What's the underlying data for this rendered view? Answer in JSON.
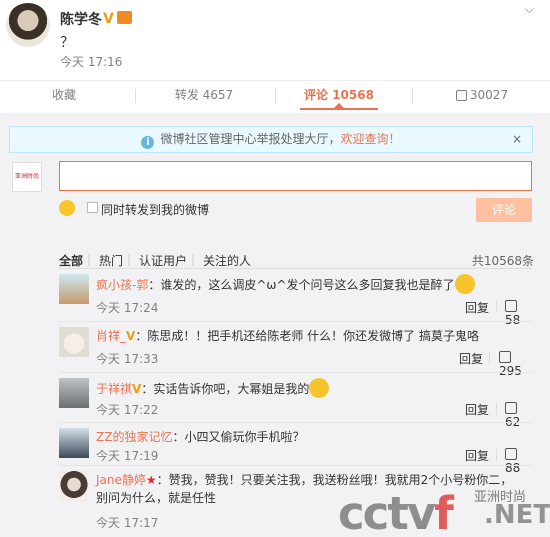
{
  "post": {
    "author": "陈学冬",
    "verified": "V",
    "text": "？",
    "time": "今天 17:16",
    "caret": "⌵"
  },
  "actions": [
    {
      "label": "收藏"
    },
    {
      "label": "转发 4657"
    },
    {
      "label": "评论 10568"
    },
    {
      "label": "30027"
    }
  ],
  "notice": {
    "prefix": "微博社区管理中心举报处理大厅，",
    "link": "欢迎查询！",
    "close": "×"
  },
  "composer": {
    "avatar_text": "亚洲时尚",
    "reply_value": "",
    "repost_label": "同时转发到我的微博",
    "submit_label": "评论"
  },
  "filters": {
    "items": [
      "全部",
      "热门",
      "认证用户",
      "关注的人"
    ],
    "total": "共10568条"
  },
  "comments": [
    {
      "name": "疯小孩-郭",
      "text": "：谁发的，这么调皮^ω^发个问号这么多回复我也是醉了",
      "time": "今天 17:24",
      "reply": "回复",
      "likes": "58"
    },
    {
      "name": "肖祥_",
      "badge": "V",
      "text": "：陈思成！！把手机还给陈老师 什么！你还发微博了 搞莫子鬼咯",
      "time": "今天 17:33",
      "reply": "回复",
      "likes": "295"
    },
    {
      "name": "于祥祺",
      "badge": "V",
      "text": "：实话告诉你吧，大幂姐是我的",
      "time": "今天 17:22",
      "reply": "回复",
      "likes": "62"
    },
    {
      "name": "ZZ的独家记忆",
      "text": "：小四又偷玩你手机啦？",
      "time": "今天 17:19",
      "reply": "回复",
      "likes": "88"
    },
    {
      "name": "Jane静婷",
      "badge": "★",
      "text": "：赞我，赞我！只要关注我，我送粉丝哦！我就用2个小号粉你二，别问为什么，就是任性",
      "time": "今天 17:17",
      "reply": "",
      "likes": ""
    }
  ],
  "watermark": {
    "brand_pre": "cctv",
    "brand_f": "f",
    "net": ".NET",
    "cn": "亚洲时尚"
  },
  "colors": {
    "accent": "#eb7350",
    "verified": "#f29b0b",
    "notice_bg": "#eaf8ff",
    "panel_bg": "#f2f2f5"
  }
}
